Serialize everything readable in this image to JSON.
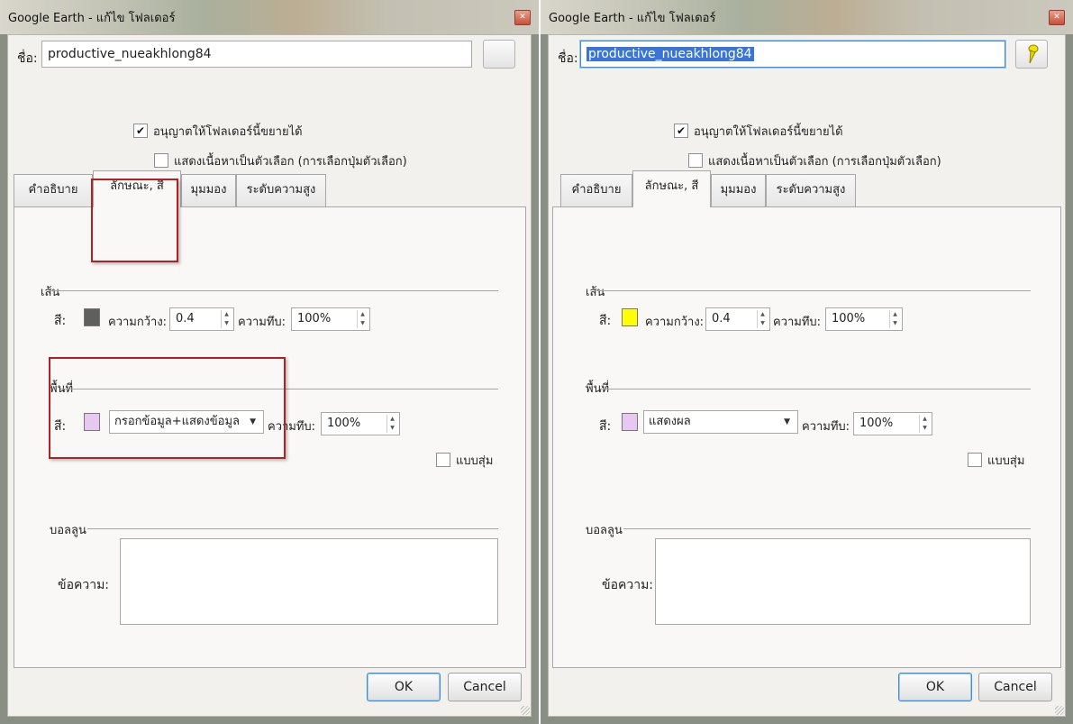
{
  "colors": {
    "left_line_swatch": "#5f5f5f",
    "right_line_swatch": "#ffff00",
    "area_swatch": "#e7c8f0",
    "highlight_border": "#b32020",
    "selection": "#3875d7"
  },
  "left": {
    "window_title": "Google Earth - แก้ไข  โฟลเดอร์",
    "name_label": "ชื่อ:",
    "name_value": "productive_nueakhlong84",
    "allow_expand_label": "อนุญาตให้โฟลเดอร์นี้ขยายได้",
    "allow_expand_checked": true,
    "show_as_options_label": "แสดงเนื้อหาเป็นตัวเลือก (การเลือกปุ่มตัวเลือก)",
    "show_as_options_checked": false,
    "tabs": [
      "คำอธิบาย",
      "ลักษณะ, สี",
      "มุมมอง",
      "ระดับความสูง"
    ],
    "active_tab": 1,
    "line_group_label": "เส้น",
    "line_color_label": "สี:",
    "width_label": "ความกว้าง:",
    "width_value": "0.4",
    "opacity_label": "ความทึบ:",
    "line_opacity": "100%",
    "area_group_label": "พื้นที่",
    "area_color_label": "สี:",
    "area_mode": "กรอกข้อมูล+แสดงข้อมูล",
    "area_opacity_label": "ความทึบ:",
    "area_opacity": "100%",
    "random_label": "แบบสุ่ม",
    "random_checked": false,
    "balloon_group_label": "บอลลูน",
    "message_label": "ข้อความ:",
    "message_value": "",
    "ok_label": "OK",
    "cancel_label": "Cancel"
  },
  "right": {
    "window_title": "Google Earth - แก้ไข  โฟลเดอร์",
    "name_label": "ชื่อ:",
    "name_value": "productive_nueakhlong84",
    "allow_expand_label": "อนุญาตให้โฟลเดอร์นี้ขยายได้",
    "allow_expand_checked": true,
    "show_as_options_label": "แสดงเนื้อหาเป็นตัวเลือก (การเลือกปุ่มตัวเลือก)",
    "show_as_options_checked": false,
    "tabs": [
      "คำอธิบาย",
      "ลักษณะ, สี",
      "มุมมอง",
      "ระดับความสูง"
    ],
    "active_tab": 1,
    "line_group_label": "เส้น",
    "line_color_label": "สี:",
    "width_label": "ความกว้าง:",
    "width_value": "0.4",
    "opacity_label": "ความทึบ:",
    "line_opacity": "100%",
    "area_group_label": "พื้นที่",
    "area_color_label": "สี:",
    "area_mode": "แสดงผล",
    "area_opacity_label": "ความทึบ:",
    "area_opacity": "100%",
    "random_label": "แบบสุ่ม",
    "random_checked": false,
    "balloon_group_label": "บอลลูน",
    "message_label": "ข้อความ:",
    "message_value": "",
    "ok_label": "OK",
    "cancel_label": "Cancel"
  }
}
